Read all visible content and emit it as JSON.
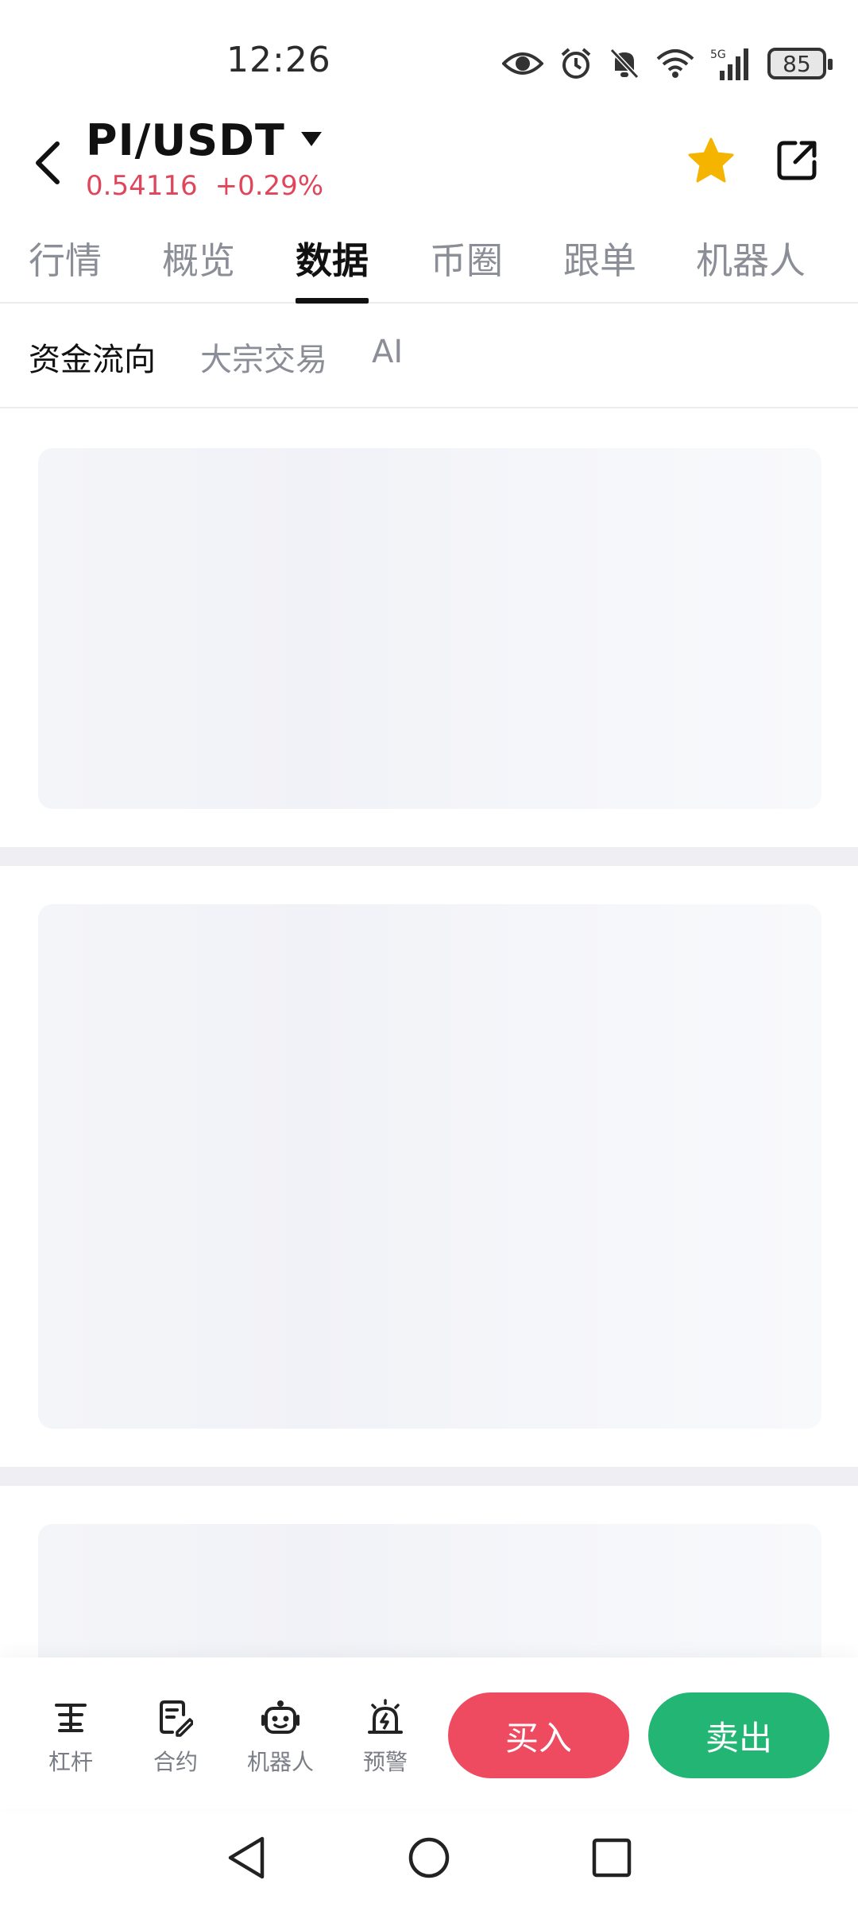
{
  "status_bar": {
    "time": "12:26",
    "battery": "85",
    "network": "5G"
  },
  "header": {
    "pair": "PI/USDT",
    "price": "0.54116",
    "change": "+0.29%"
  },
  "main_tabs": [
    {
      "label": "行情"
    },
    {
      "label": "概览"
    },
    {
      "label": "数据"
    },
    {
      "label": "币圈"
    },
    {
      "label": "跟单"
    },
    {
      "label": "机器人"
    }
  ],
  "active_main_tab": "数据",
  "sub_tabs": [
    {
      "label": "资金流向"
    },
    {
      "label": "大宗交易"
    },
    {
      "label": "AI"
    }
  ],
  "active_sub_tab": "资金流向",
  "bottom_tools": [
    {
      "label": "杠杆",
      "icon": "leverage-icon"
    },
    {
      "label": "合约",
      "icon": "contract-icon"
    },
    {
      "label": "机器人",
      "icon": "robot-icon"
    },
    {
      "label": "预警",
      "icon": "alert-icon"
    }
  ],
  "actions": {
    "buy": "买入",
    "sell": "卖出"
  },
  "colors": {
    "accent_red": "#e0465b",
    "buy": "#ee4a60",
    "sell": "#22b573",
    "star": "#f5b400"
  }
}
